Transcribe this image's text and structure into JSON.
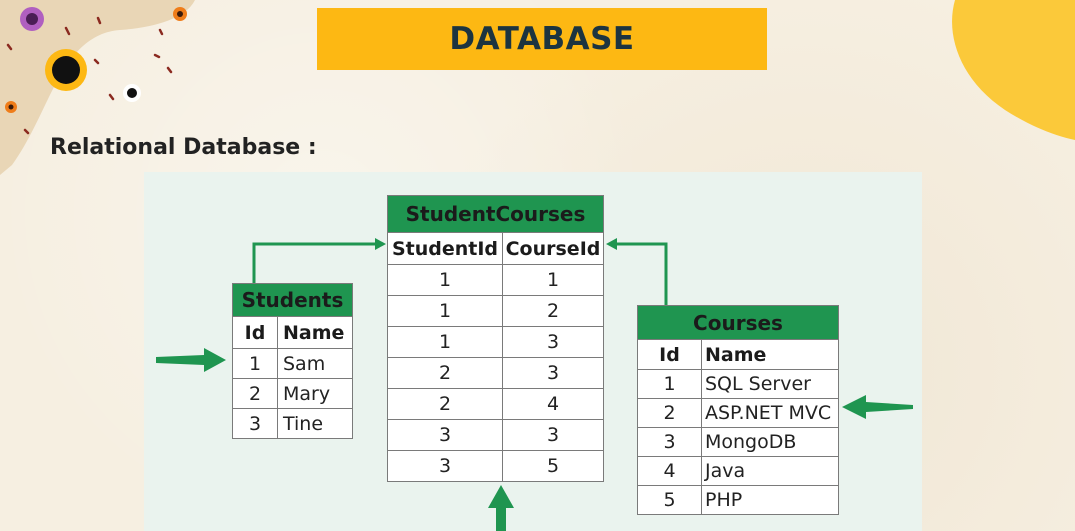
{
  "slide": {
    "title": "DATABASE",
    "subtitle": "Relational Database :"
  },
  "colors": {
    "title_banner": "#fdb813",
    "title_text": "#1c3440",
    "table_header": "#1f9550",
    "arrow": "#1f9550",
    "panel_bg": "#eaf3ee"
  },
  "tables": {
    "students": {
      "name": "Students",
      "columns": [
        "Id",
        "Name"
      ],
      "rows": [
        [
          "1",
          "Sam"
        ],
        [
          "2",
          "Mary"
        ],
        [
          "3",
          "Tine"
        ]
      ]
    },
    "student_courses": {
      "name": "StudentCourses",
      "columns": [
        "StudentId",
        "CourseId"
      ],
      "rows": [
        [
          "1",
          "1"
        ],
        [
          "1",
          "2"
        ],
        [
          "1",
          "3"
        ],
        [
          "2",
          "3"
        ],
        [
          "2",
          "4"
        ],
        [
          "3",
          "3"
        ],
        [
          "3",
          "5"
        ]
      ]
    },
    "courses": {
      "name": "Courses",
      "columns": [
        "Id",
        "Name"
      ],
      "rows": [
        [
          "1",
          "SQL Server"
        ],
        [
          "2",
          "ASP.NET MVC"
        ],
        [
          "3",
          "MongoDB"
        ],
        [
          "4",
          "Java"
        ],
        [
          "5",
          "PHP"
        ]
      ]
    }
  }
}
